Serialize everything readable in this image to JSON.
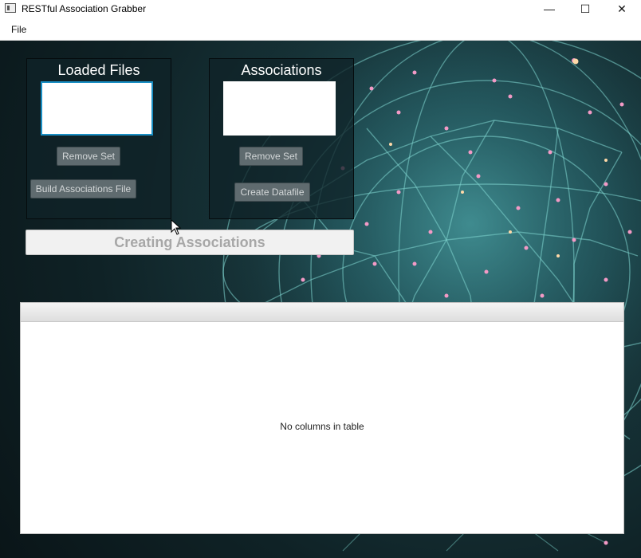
{
  "window": {
    "title": "RESTful Association Grabber",
    "minimize_glyph": "—",
    "maximize_glyph": "☐",
    "close_glyph": "✕"
  },
  "menu": {
    "items": [
      {
        "label": "File"
      }
    ]
  },
  "loaded_files_panel": {
    "title": "Loaded Files",
    "remove_set_label": "Remove Set",
    "build_associations_label": "Build Associations File"
  },
  "associations_panel": {
    "title": "Associations",
    "remove_set_label": "Remove Set",
    "create_datafile_label": "Create Datafile"
  },
  "progress": {
    "label": "Creating Associations",
    "value": 0
  },
  "table": {
    "placeholder": "No columns in table"
  },
  "colors": {
    "accent_focus": "#1a8fc4",
    "button_bg": "#5f6b6f",
    "panel_bg": "#10222a"
  }
}
